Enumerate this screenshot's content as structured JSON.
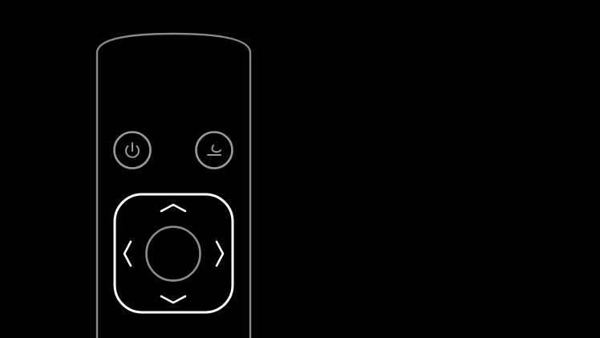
{
  "theme": {
    "background": "#000000",
    "remote_outline_color": "#8a8a8a",
    "button_outline_color": "#9a9a9a",
    "dpad_outline_color": "#ffffff",
    "center_button_color": "#8c8c8c"
  },
  "remote": {
    "buttons": {
      "power": {
        "icon": "power-icon"
      },
      "back": {
        "icon": "back-arrow-icon"
      }
    },
    "dpad": {
      "up": {
        "icon": "chevron-up-icon"
      },
      "down": {
        "icon": "chevron-down-icon"
      },
      "left": {
        "icon": "chevron-left-icon"
      },
      "right": {
        "icon": "chevron-right-icon"
      },
      "center": {
        "icon": "select-circle-icon"
      }
    }
  }
}
